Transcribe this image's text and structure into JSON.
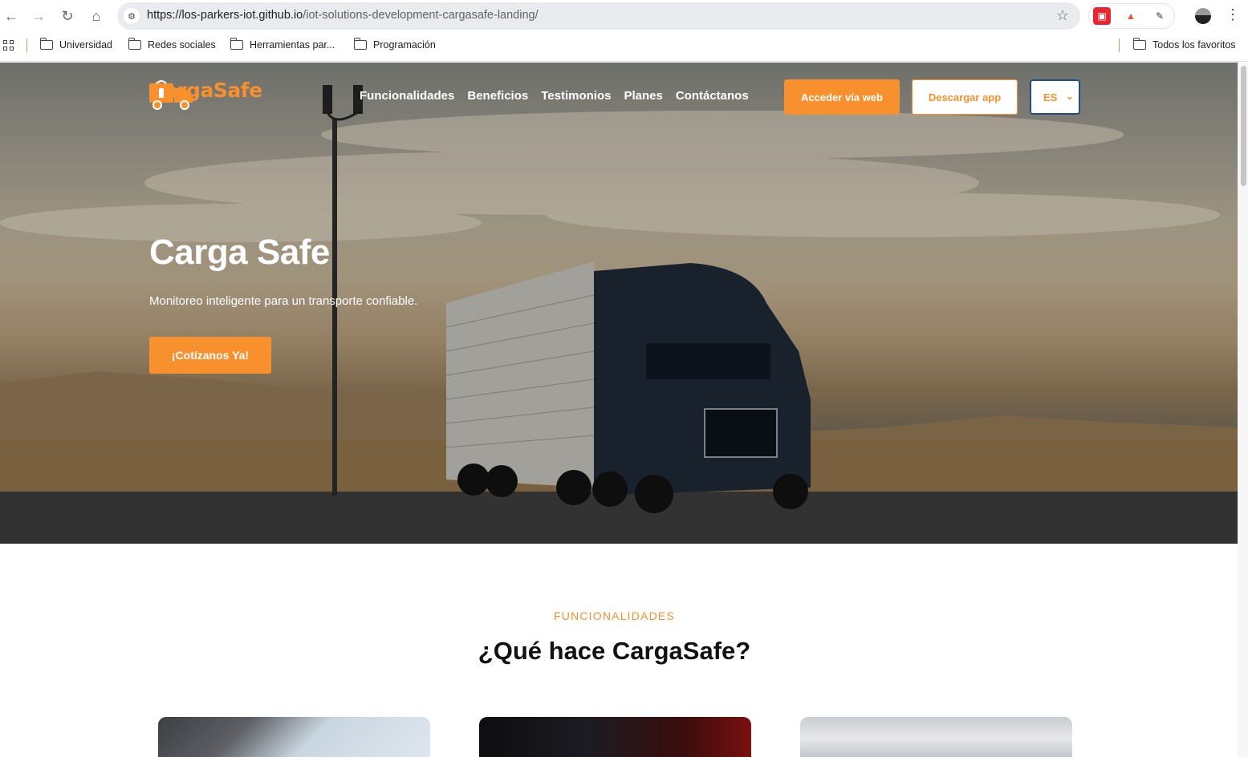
{
  "browser": {
    "url_host": "https://los-parkers-iot.github.io",
    "url_path": "/iot-solutions-development-cargasafe-landing/",
    "bookmarks": [
      "Universidad",
      "Redes sociales",
      "Herramientas par...",
      "Programación"
    ],
    "all_bookmarks": "Todos los favoritos"
  },
  "header": {
    "logo_text": "CargaSafe",
    "nav": [
      "Funcionalidades",
      "Beneficios",
      "Testimonios",
      "Planes",
      "Contáctanos"
    ],
    "web_button": "Acceder vía web",
    "app_button": "Descargar app",
    "language": "ES"
  },
  "hero": {
    "title": "Carga Safe",
    "subtitle": "Monitoreo inteligente para un transporte confiable.",
    "cta": "¡Cotízanos Ya!"
  },
  "features": {
    "eyebrow": "FUNCIONALIDADES",
    "title": "¿Qué hace CargaSafe?"
  },
  "colors": {
    "accent": "#f7902d",
    "select_border": "#1f4d8a"
  }
}
